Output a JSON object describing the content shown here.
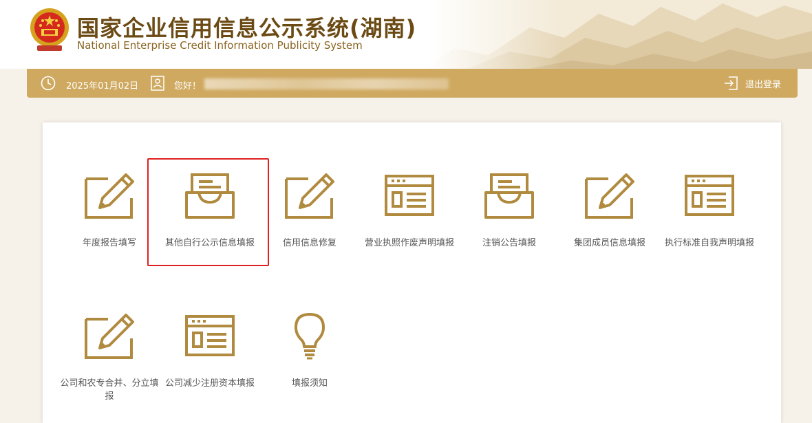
{
  "header": {
    "title_cn": "国家企业信用信息公示系统(湖南)",
    "title_en": "National Enterprise Credit Information Publicity System"
  },
  "topbar": {
    "date": "2025年01月02日",
    "greeting": "您好！",
    "logout_label": "退出登录"
  },
  "colors": {
    "accent": "#cfa960",
    "icon": "#b08a3e",
    "title": "#6b4a14",
    "highlight": "#e02020"
  },
  "tiles": [
    {
      "label": "年度报告填写",
      "icon": "edit-pencil-icon"
    },
    {
      "label": "其他自行公示信息填报",
      "icon": "inbox-tray-icon"
    },
    {
      "label": "信用信息修复",
      "icon": "edit-pencil-icon"
    },
    {
      "label": "营业执照作废声明填报",
      "icon": "document-card-icon"
    },
    {
      "label": "注销公告填报",
      "icon": "inbox-tray-icon"
    },
    {
      "label": "集团成员信息填报",
      "icon": "edit-pencil-icon"
    },
    {
      "label": "执行标准自我声明填报",
      "icon": "document-card-icon"
    },
    {
      "label": "公司和农专合并、分立填报",
      "icon": "edit-pencil-icon"
    },
    {
      "label": "公司减少注册资本填报",
      "icon": "document-card-icon"
    },
    {
      "label": "填报须知",
      "icon": "lightbulb-icon"
    }
  ]
}
